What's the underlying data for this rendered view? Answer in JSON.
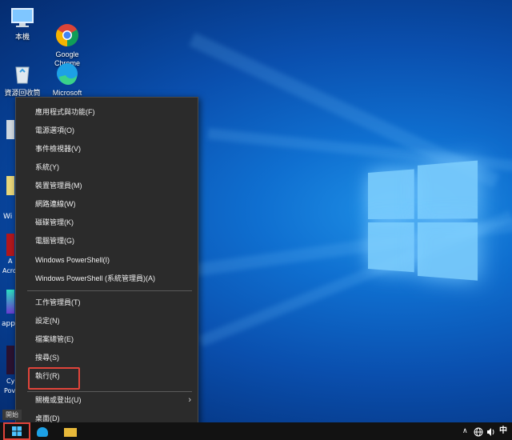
{
  "desktop": {
    "icons": [
      {
        "label": "本機"
      },
      {
        "label": "Google\nChrome"
      },
      {
        "label": "資源回收筒"
      },
      {
        "label": "Microsoft"
      }
    ],
    "partial_labels": [
      "Wi",
      "A",
      "Acro",
      "app",
      "Cy",
      "Pov"
    ]
  },
  "menu": {
    "items": [
      {
        "label": "應用程式與功能(F)"
      },
      {
        "label": "電源選項(O)"
      },
      {
        "label": "事件檢視器(V)"
      },
      {
        "label": "系統(Y)"
      },
      {
        "label": "裝置管理員(M)"
      },
      {
        "label": "網路連線(W)"
      },
      {
        "label": "磁碟管理(K)"
      },
      {
        "label": "電腦管理(G)"
      },
      {
        "label": "Windows PowerShell(I)"
      },
      {
        "label": "Windows PowerShell (系統管理員)(A)"
      },
      {
        "label": "工作管理員(T)"
      },
      {
        "label": "設定(N)"
      },
      {
        "label": "檔案總管(E)"
      },
      {
        "label": "搜尋(S)"
      },
      {
        "label": "執行(R)"
      },
      {
        "label": "關機或登出(U)"
      },
      {
        "label": "桌面(D)"
      }
    ],
    "submenu_arrow": "›"
  },
  "taskbar": {
    "tooltip": "開始",
    "tray": {
      "chevron": "∧",
      "ime": "中"
    }
  },
  "colors": {
    "highlight": "#e0443a",
    "menu_bg": "#2b2b2b"
  }
}
